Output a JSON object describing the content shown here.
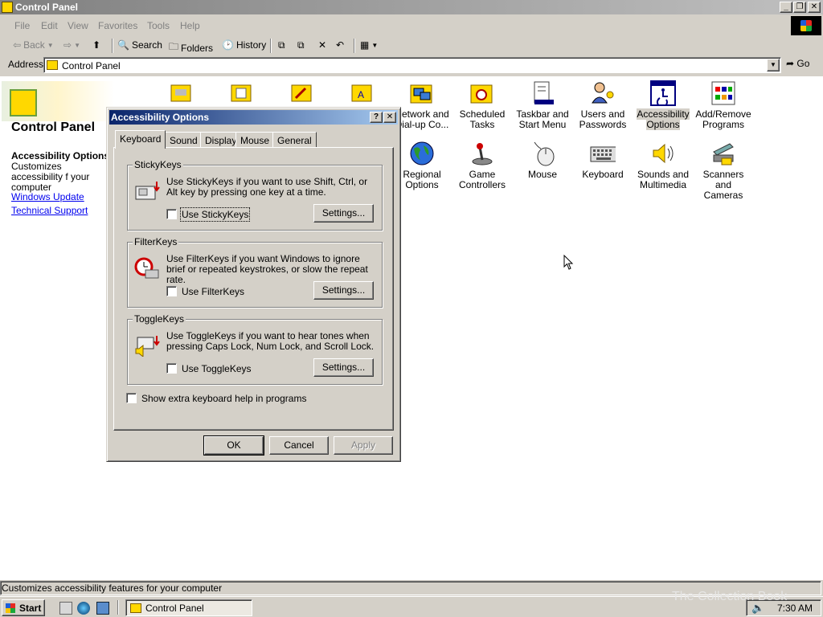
{
  "window": {
    "title": "Control Panel"
  },
  "menu": [
    "File",
    "Edit",
    "View",
    "Favorites",
    "Tools",
    "Help"
  ],
  "toolbar": {
    "back": "Back",
    "search": "Search",
    "folders": "Folders",
    "history": "History"
  },
  "address": {
    "label": "Address",
    "value": "Control Panel",
    "go": "Go"
  },
  "left_panel": {
    "title": "Control Panel",
    "selected_title": "Accessibility Options",
    "selected_desc": "Customizes accessibility f your computer",
    "links": [
      "Windows Update",
      "Technical Support"
    ]
  },
  "icons": [
    {
      "label": "Network and Dial-up Co..."
    },
    {
      "label": "Scheduled Tasks"
    },
    {
      "label": "Taskbar and Start Menu"
    },
    {
      "label": "Users and Passwords"
    },
    {
      "label": "Accessibility Options",
      "selected": true
    },
    {
      "label": "Add/Remove Programs"
    },
    {
      "label": "Regional Options"
    },
    {
      "label": "Game Controllers"
    },
    {
      "label": "Mouse"
    },
    {
      "label": "Keyboard"
    },
    {
      "label": "Sounds and Multimedia"
    },
    {
      "label": "Scanners and Cameras"
    }
  ],
  "dialog": {
    "title": "Accessibility Options",
    "tabs": [
      "Keyboard",
      "Sound",
      "Display",
      "Mouse",
      "General"
    ],
    "active_tab": "Keyboard",
    "groups": [
      {
        "title": "StickyKeys",
        "desc": "Use StickyKeys if you want to use Shift, Ctrl, or Alt key by pressing one key at a time.",
        "checkbox": "Use StickyKeys",
        "checked": false,
        "settings": "Settings..."
      },
      {
        "title": "FilterKeys",
        "desc": "Use FilterKeys if you want Windows to ignore brief or repeated keystrokes, or slow the repeat rate.",
        "checkbox": "Use FilterKeys",
        "checked": false,
        "settings": "Settings..."
      },
      {
        "title": "ToggleKeys",
        "desc": "Use ToggleKeys if you want to hear tones when pressing Caps Lock, Num Lock, and Scroll Lock.",
        "checkbox": "Use ToggleKeys",
        "checked": false,
        "settings": "Settings..."
      }
    ],
    "extra_help": "Show extra keyboard help in programs",
    "buttons": {
      "ok": "OK",
      "cancel": "Cancel",
      "apply": "Apply"
    }
  },
  "status": "Customizes accessibility features for your computer",
  "taskbar": {
    "start": "Start",
    "task": "Control Panel",
    "clock": "7:30 AM"
  },
  "watermark": "The Collection Book"
}
